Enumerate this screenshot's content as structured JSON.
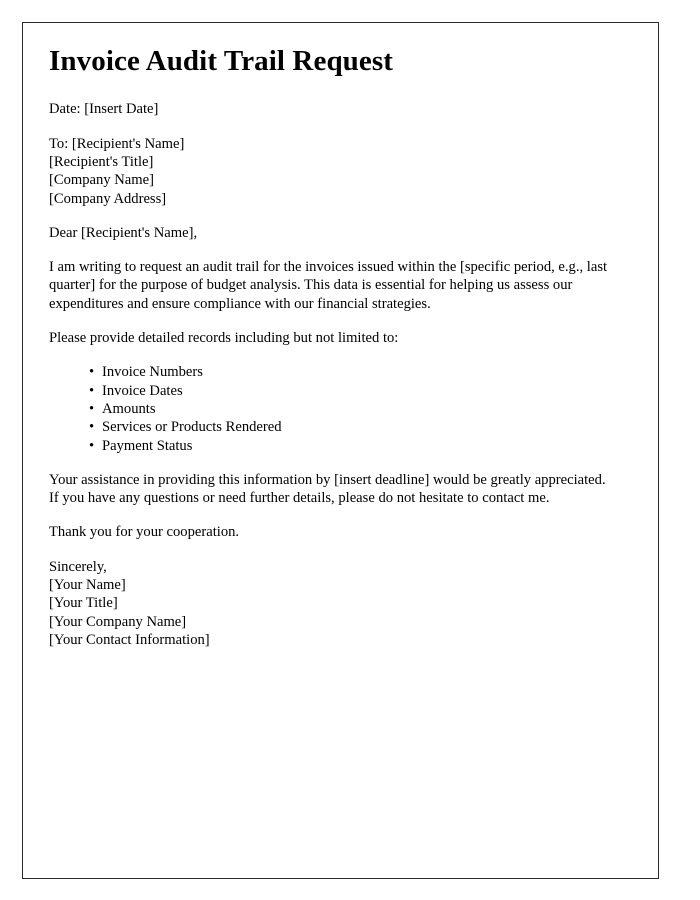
{
  "document": {
    "title": "Invoice Audit Trail Request",
    "date_line": "Date: [Insert Date]",
    "recipient_block": [
      "To: [Recipient's Name]",
      "[Recipient's Title]",
      "[Company Name]",
      "[Company Address]"
    ],
    "salutation": "Dear [Recipient's Name],",
    "intro_paragraph": "I am writing to request an audit trail for the invoices issued within the [specific period, e.g., last quarter] for the purpose of budget analysis. This data is essential for helping us assess our expenditures and ensure compliance with our financial strategies.",
    "records_intro": "Please provide detailed records including but not limited to:",
    "records_list": [
      "Invoice Numbers",
      "Invoice Dates",
      "Amounts",
      "Services or Products Rendered",
      "Payment Status"
    ],
    "bullet_glyph": "•",
    "closing_paragraph": "Your assistance in providing this information by [insert deadline] would be greatly appreciated. If you have any questions or need further details, please do not hesitate to contact me.",
    "thanks_line": "Thank you for your cooperation.",
    "signature_block": [
      "Sincerely,",
      "[Your Name]",
      "[Your Title]",
      "[Your Company Name]",
      "[Your Contact Information]"
    ]
  },
  "style": {
    "page_background": "#ffffff",
    "border_color": "#2b2b2b",
    "text_color": "#000000"
  }
}
